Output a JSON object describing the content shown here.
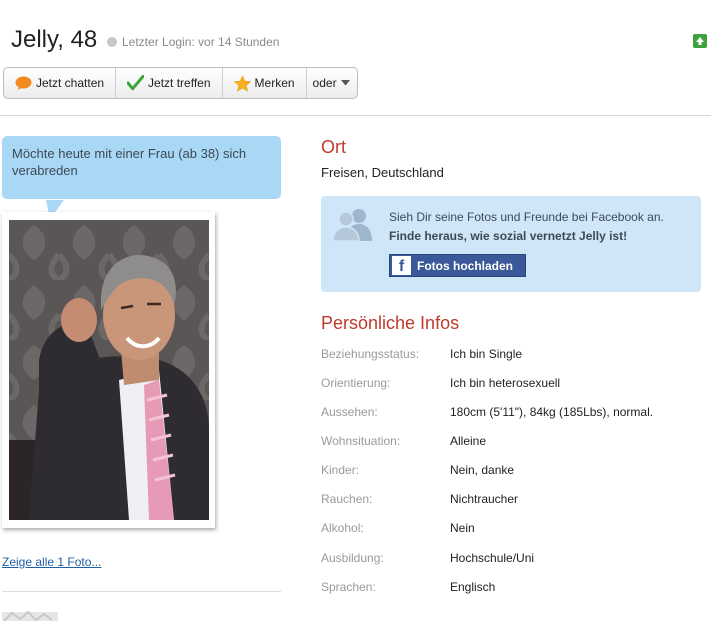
{
  "header": {
    "title": "Jelly, 48",
    "last_login": "Letzter Login: vor 14 Stunden"
  },
  "actions": {
    "chat_label": "Jetzt chatten",
    "meet_label": "Jetzt treffen",
    "save_label": "Merken",
    "more_label": "oder"
  },
  "bubble_text": "Möchte heute mit einer Frau (ab 38) sich verabreden",
  "fotos_link": "Zeige alle 1 Foto...",
  "location": {
    "heading": "Ort",
    "value": "Freisen, Deutschland"
  },
  "facebook": {
    "line1": "Sieh Dir seine Fotos und Freunde bei Facebook an.",
    "line2": "Finde heraus, wie sozial vernetzt Jelly ist!",
    "button_label": "Fotos hochladen"
  },
  "infos": {
    "heading": "Persönliche Infos",
    "rows": [
      {
        "label": "Beziehungsstatus:",
        "value": "Ich bin Single"
      },
      {
        "label": "Orientierung:",
        "value": "Ich bin heterosexuell"
      },
      {
        "label": "Aussehen:",
        "value": "180cm (5'11\"), 84kg (185Lbs), normal."
      },
      {
        "label": "Wohnsituation:",
        "value": "Alleine"
      },
      {
        "label": "Kinder:",
        "value": "Nein, danke"
      },
      {
        "label": "Rauchen:",
        "value": "Nichtraucher"
      },
      {
        "label": "Alkohol:",
        "value": "Nein"
      },
      {
        "label": "Ausbildung:",
        "value": "Hochschule/Uni"
      },
      {
        "label": "Sprachen:",
        "value": "Englisch"
      }
    ]
  },
  "colors": {
    "heading_red": "#c0392b",
    "bubble_blue": "#a9d7f6",
    "facebook_blue": "#3b5998",
    "link_blue": "#1f5fa3"
  },
  "icons": {
    "chat": "chat-bubble-icon",
    "meet": "checkmark-icon",
    "save": "star-icon",
    "more": "chevron-down-icon",
    "up": "arrow-up-icon",
    "facebook": "facebook-f-icon",
    "people": "people-silhouette-icon"
  }
}
